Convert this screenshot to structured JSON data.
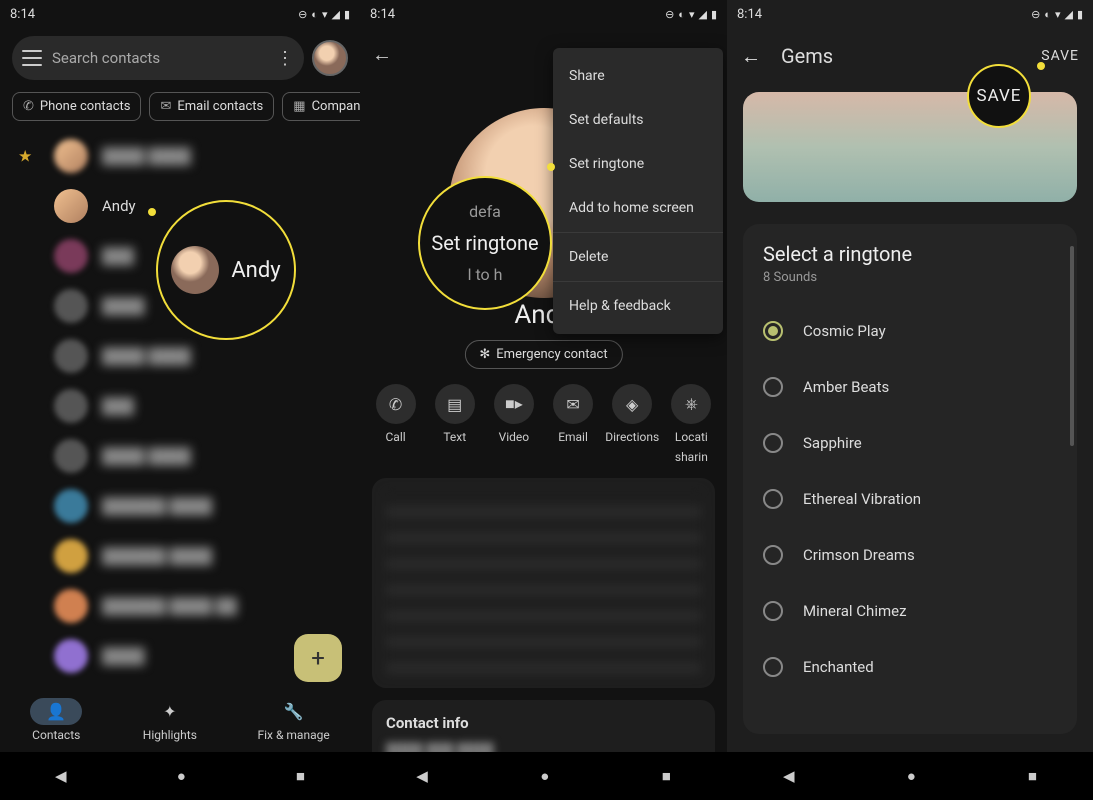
{
  "status": {
    "time": "8:14"
  },
  "panel1": {
    "search_placeholder": "Search contacts",
    "chips": {
      "phone": "Phone contacts",
      "email": "Email contacts",
      "company": "Compan"
    },
    "contacts": [
      {
        "name": "Andy"
      }
    ],
    "bottomnav": {
      "contacts": "Contacts",
      "highlights": "Highlights",
      "fixmanage": "Fix & manage"
    },
    "zoom_label": "Andy"
  },
  "panel2": {
    "name": "Andy",
    "emergency": "Emergency contact",
    "actions": {
      "call": "Call",
      "text": "Text",
      "video": "Video",
      "email": "Email",
      "directions": "Directions",
      "location": "Locati"
    },
    "location_sub": "sharin",
    "contact_info_header": "Contact info",
    "menu": {
      "share": "Share",
      "set_defaults": "Set defaults",
      "set_ringtone": "Set ringtone",
      "add_home": "Add to home screen",
      "delete": "Delete",
      "help": "Help & feedback"
    },
    "zoom_label": "Set ringtone",
    "zoom_sub1": "defa",
    "zoom_sub2": "l  to  h"
  },
  "panel3": {
    "title": "Gems",
    "save": "SAVE",
    "ringtone_header": "Select a ringtone",
    "ringtone_sub": "8 Sounds",
    "ringtones": [
      {
        "name": "Cosmic Play",
        "selected": true
      },
      {
        "name": "Amber Beats",
        "selected": false
      },
      {
        "name": "Sapphire",
        "selected": false
      },
      {
        "name": "Ethereal Vibration",
        "selected": false
      },
      {
        "name": "Crimson Dreams",
        "selected": false
      },
      {
        "name": "Mineral Chimez",
        "selected": false
      },
      {
        "name": "Enchanted",
        "selected": false
      }
    ],
    "zoom_label": "SAVE"
  }
}
